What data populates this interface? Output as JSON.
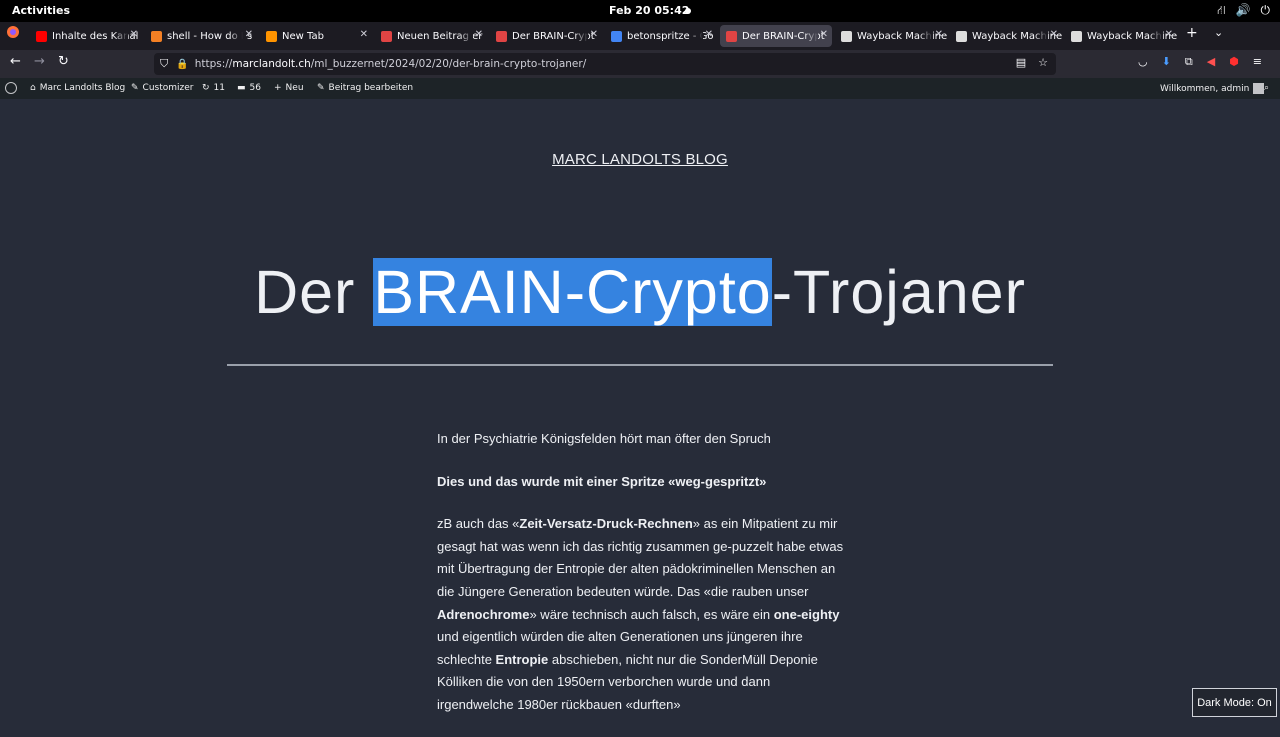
{
  "system": {
    "activities": "Activities",
    "clock": "Feb 20  05:42"
  },
  "tabs": [
    {
      "title": "Inhalte des Kanal",
      "favicon": "youtube-icon",
      "color": "#ff0000"
    },
    {
      "title": "shell - How do I s",
      "favicon": "stackoverflow-icon",
      "color": "#f48024"
    },
    {
      "title": "New Tab",
      "favicon": "firefox-icon",
      "color": "#ff9400"
    },
    {
      "title": "Neuen Beitrag er",
      "favicon": "blog-icon",
      "color": "#e04444"
    },
    {
      "title": "Der BRAIN-Crypt",
      "favicon": "blog-icon",
      "color": "#e04444"
    },
    {
      "title": "betonspritze - Go",
      "favicon": "google-icon",
      "color": "#4285f4"
    },
    {
      "title": "Der BRAIN-Crypt",
      "favicon": "blog-icon",
      "color": "#e04444",
      "active": true
    },
    {
      "title": "Wayback Machine",
      "favicon": "wayback-icon",
      "color": "#dddddd"
    },
    {
      "title": "Wayback Machine",
      "favicon": "wayback-icon",
      "color": "#dddddd"
    },
    {
      "title": "Wayback Machine",
      "favicon": "wayback-icon",
      "color": "#dddddd"
    }
  ],
  "urlbar": {
    "scheme": "https://",
    "host": "marclandolt.ch",
    "path": "/ml_buzzernet/2024/02/20/der-brain-crypto-trojaner/"
  },
  "wpbar": {
    "site": "Marc Landolts Blog",
    "customizer": "Customizer",
    "updates": "11",
    "comments": "56",
    "new": "Neu",
    "edit": "Beitrag bearbeiten",
    "welcome": "Willkommen, admin"
  },
  "page": {
    "site_title": "MARC LANDOLTS BLOG",
    "title_before": "Der ",
    "title_selected": "BRAIN-Crypto",
    "title_after": "-Trojaner",
    "p1": "In der Psychiatrie Königsfelden hört man öfter den Spruch",
    "p2": "Dies und das wurde mit einer Spritze «weg-gespritzt»",
    "p3_parts": [
      {
        "t": "zB auch das «",
        "b": false
      },
      {
        "t": "Zeit-Versatz-Druck-Rechnen",
        "b": true
      },
      {
        "t": "» as ein Mitpatient zu mir gesagt hat was wenn ich das richtig zusammen ge-puzzelt habe etwas mit Übertragung der Entropie der alten pädokriminellen Menschen an die Jüngere Generation bedeuten würde. Das «die rauben unser ",
        "b": false
      },
      {
        "t": "Adrenochrome",
        "b": true
      },
      {
        "t": "» wäre technisch auch falsch, es wäre ein ",
        "b": false
      },
      {
        "t": "one-eighty",
        "b": true
      },
      {
        "t": " und eigentlich würden die alten Generationen uns jüngeren ihre schlechte ",
        "b": false
      },
      {
        "t": "Entropie",
        "b": true
      },
      {
        "t": " abschieben, nicht nur die SonderMüll Deponie Kölliken die von den 1950ern verborchen wurde und dann irgendwelche 1980er rückbauen «durften»",
        "b": false
      }
    ],
    "dark_mode": "Dark Mode: On"
  }
}
